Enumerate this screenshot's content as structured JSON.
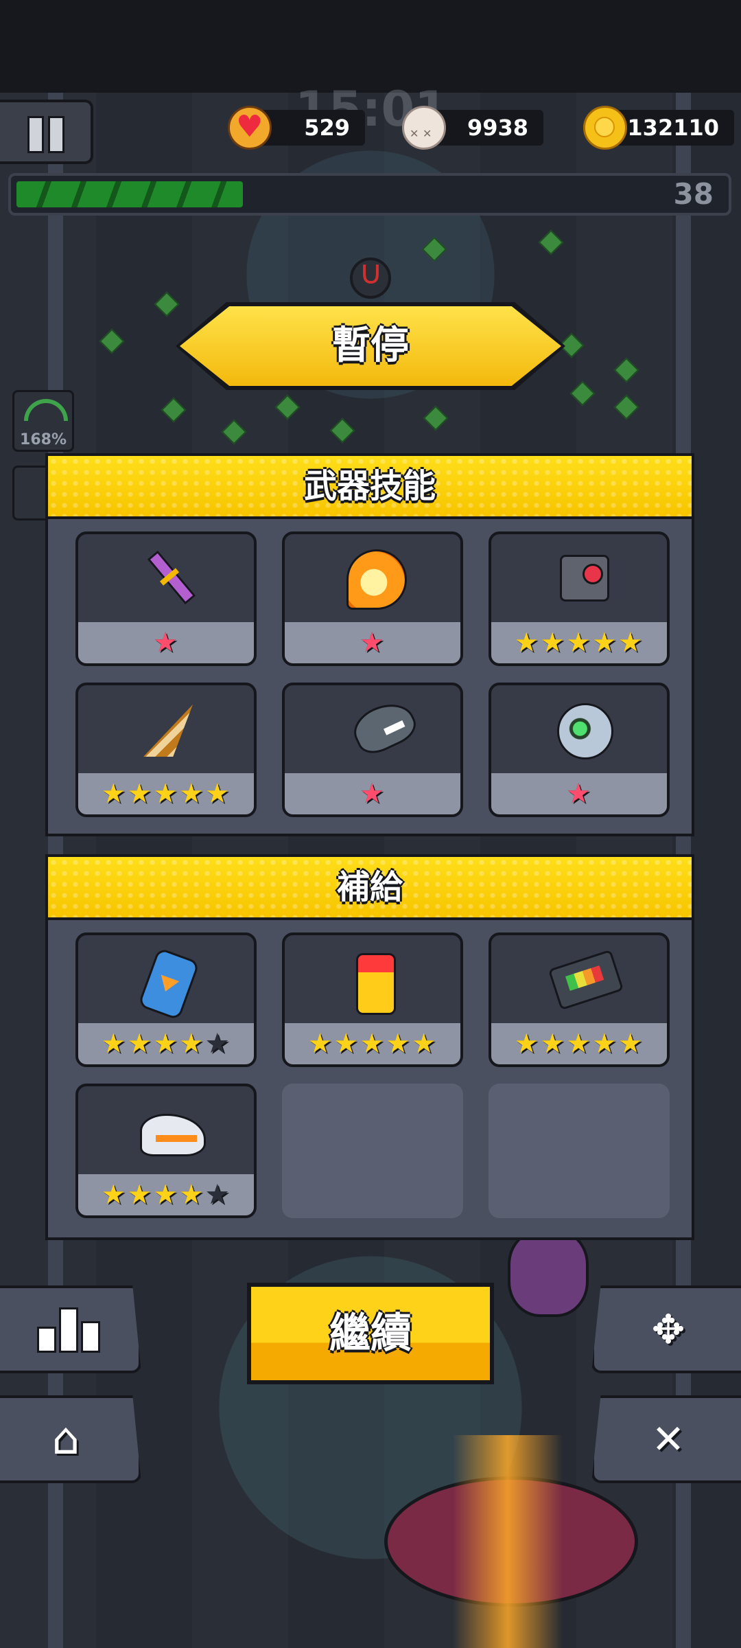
{
  "hud": {
    "timer": "15:01",
    "hearts": "529",
    "kills": "9938",
    "coins": "132110",
    "level": "38",
    "xp_progress": 0.32,
    "side_gauge": "168%"
  },
  "title": "暫停",
  "weapons": {
    "title": "武器技能",
    "items": [
      {
        "icon": "sword-icon",
        "stars": 1,
        "max": 1,
        "color": "pink"
      },
      {
        "icon": "fireball-icon",
        "stars": 1,
        "max": 1,
        "color": "pink"
      },
      {
        "icon": "camera-drone-icon",
        "stars": 5,
        "max": 5,
        "color": "gold"
      },
      {
        "icon": "drill-icon",
        "stars": 5,
        "max": 5,
        "color": "gold"
      },
      {
        "icon": "shark-rocket-icon",
        "stars": 1,
        "max": 1,
        "color": "pink"
      },
      {
        "icon": "orb-drone-icon",
        "stars": 1,
        "max": 1,
        "color": "pink"
      }
    ]
  },
  "supplies": {
    "title": "補給",
    "items": [
      {
        "icon": "potion-bottle-icon",
        "stars": 4,
        "max": 5,
        "color": "gold"
      },
      {
        "icon": "battery-icon",
        "stars": 5,
        "max": 5,
        "color": "gold"
      },
      {
        "icon": "circuit-chip-icon",
        "stars": 5,
        "max": 5,
        "color": "gold"
      },
      {
        "icon": "sneaker-icon",
        "stars": 4,
        "max": 5,
        "color": "gold"
      }
    ],
    "empty_slots": 2
  },
  "buttons": {
    "continue": "繼續"
  },
  "icons": {
    "stats": "bar-chart-icon",
    "home": "home-icon",
    "move": "move-arrows-icon",
    "mute": "mute-icon"
  }
}
